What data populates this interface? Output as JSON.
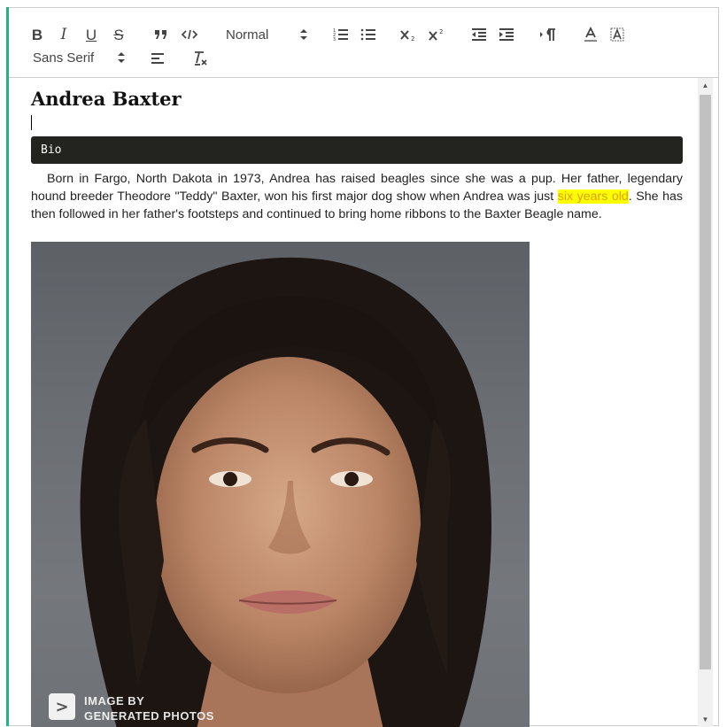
{
  "toolbar": {
    "header_picker": "Normal",
    "font_picker": "Sans Serif",
    "buttons": {
      "bold": "B",
      "italic": "I",
      "underline": "U",
      "strike": "S"
    }
  },
  "document": {
    "title": "Andrea Baxter",
    "code_block": "Bio",
    "bio_before": "Born in Fargo, North Dakota in 1973, Andrea has raised beagles since she was a pup. Her father, legendary hound breeder Theodore \"Teddy\" Baxter, won his first major dog show when Andrea was just ",
    "bio_highlight": "six years old",
    "bio_after": ". She has then followed in her father's footsteps and continued to bring home ribbons to the Baxter Beagle name.",
    "photo": {
      "watermark_line1": "IMAGE BY",
      "watermark_line2": "GENERATED PHOTOS",
      "watermark_logo": ">"
    }
  },
  "colors": {
    "accent": "#1fb57e",
    "highlight_bg": "#ffff00",
    "highlight_text": "#e0a000",
    "code_bg": "#23241f"
  },
  "icons": [
    "bold-icon",
    "italic-icon",
    "underline-icon",
    "strike-icon",
    "blockquote-icon",
    "code-icon",
    "ordered-list-icon",
    "bullet-list-icon",
    "subscript-icon",
    "superscript-icon",
    "outdent-icon",
    "indent-icon",
    "text-direction-icon",
    "text-color-icon",
    "background-color-icon",
    "align-icon",
    "clean-format-icon"
  ]
}
